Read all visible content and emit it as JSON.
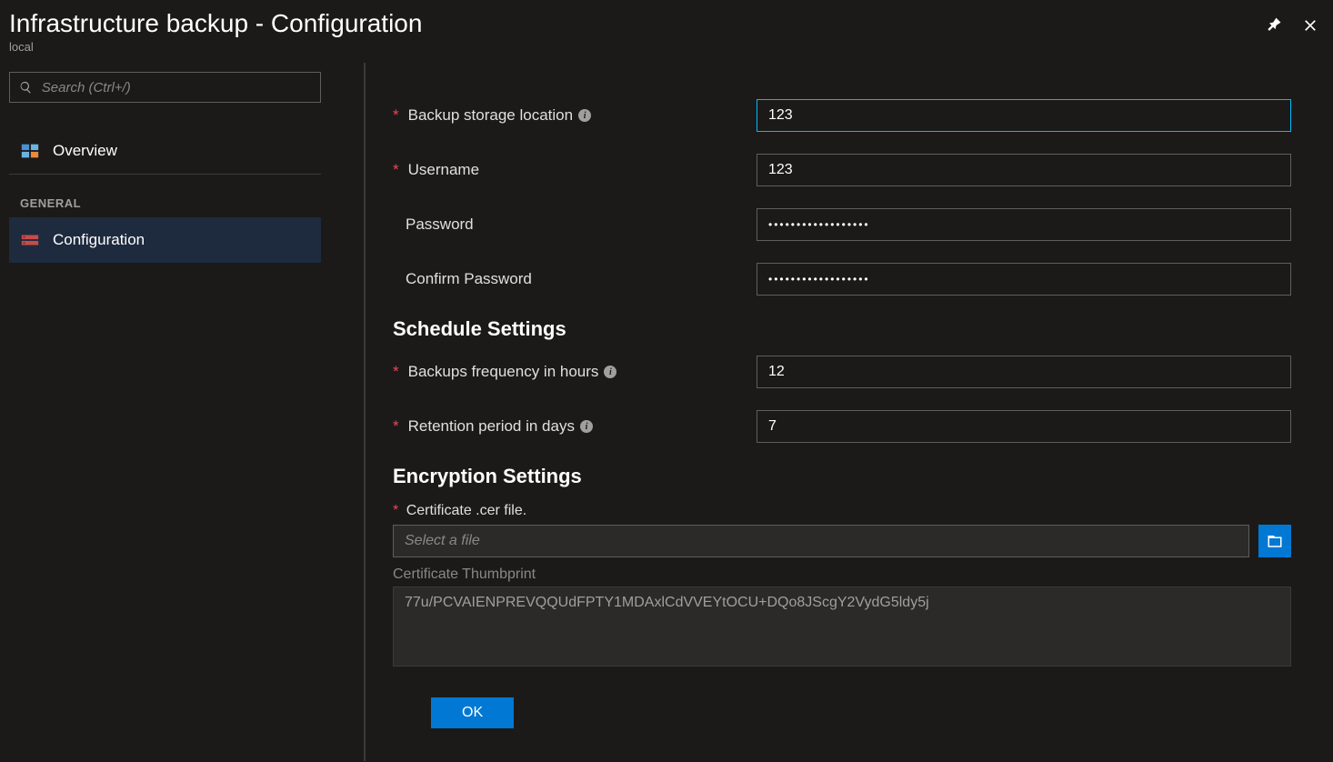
{
  "header": {
    "title": "Infrastructure backup - Configuration",
    "subtitle": "local"
  },
  "sidebar": {
    "search_placeholder": "Search (Ctrl+/)",
    "overview_label": "Overview",
    "general_heading": "GENERAL",
    "configuration_label": "Configuration"
  },
  "form": {
    "backup_location_label": "Backup storage location",
    "backup_location_value": "123",
    "username_label": "Username",
    "username_value": "123",
    "password_label": "Password",
    "password_value": "••••••••••••••••••",
    "confirm_password_label": "Confirm Password",
    "confirm_password_value": "••••••••••••••••••",
    "schedule_heading": "Schedule Settings",
    "frequency_label": "Backups frequency in hours",
    "frequency_value": "12",
    "retention_label": "Retention period in days",
    "retention_value": "7",
    "encryption_heading": "Encryption Settings",
    "certificate_label": "Certificate .cer file.",
    "certificate_placeholder": "Select a file",
    "thumbprint_label": "Certificate Thumbprint",
    "thumbprint_value": "77u/PCVAIENPREVQQUdFPTY1MDAxlCdVVEYtOCU+DQo8JScgY2VydG5ldy5j",
    "ok_label": "OK"
  }
}
